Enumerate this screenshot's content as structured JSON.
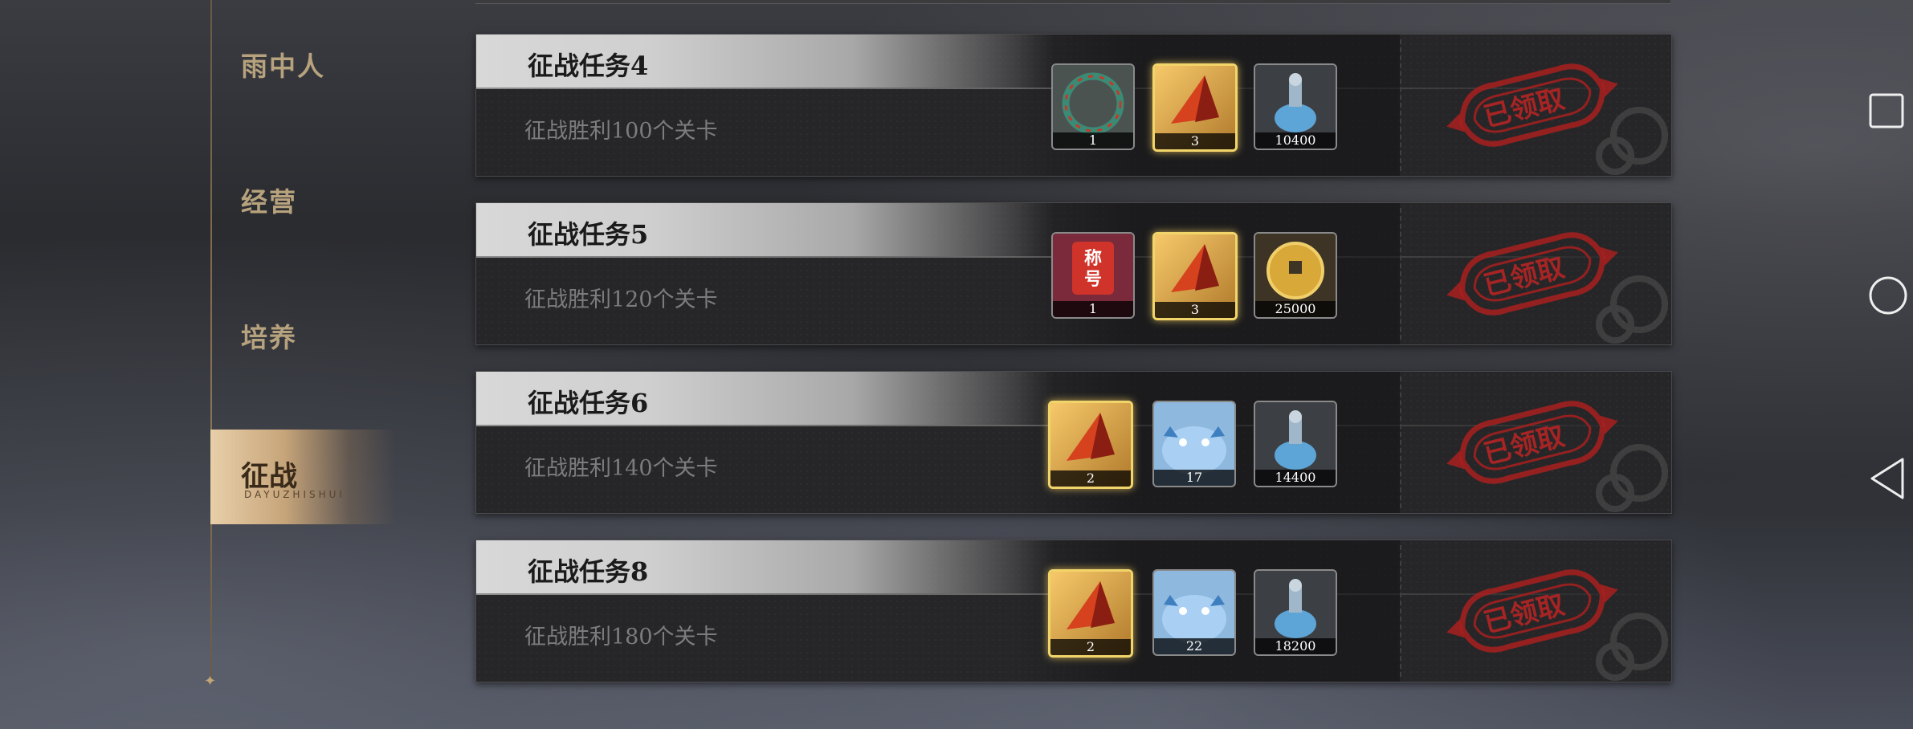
{
  "sidebar": {
    "items": [
      {
        "label": "雨中人"
      },
      {
        "label": "经营"
      },
      {
        "label": "培养"
      }
    ],
    "active": {
      "label": "征战",
      "sub": "DAYUZHISHUI"
    }
  },
  "tasks": [
    {
      "title": "征战任务4",
      "desc": "征战胜利100个关卡",
      "status": "已领取",
      "rewards": [
        {
          "icon": "jade-ring-icon",
          "count": "1"
        },
        {
          "icon": "flame-shard-icon",
          "count": "3"
        },
        {
          "icon": "potion-bottle-icon",
          "count": "10400"
        }
      ]
    },
    {
      "title": "征战任务5",
      "desc": "征战胜利120个关卡",
      "status": "已领取",
      "rewards": [
        {
          "icon": "title-badge-icon",
          "label": "称号",
          "count": "1"
        },
        {
          "icon": "flame-shard-icon",
          "count": "3"
        },
        {
          "icon": "gold-coin-icon",
          "count": "25000"
        }
      ]
    },
    {
      "title": "征战任务6",
      "desc": "征战胜利140个关卡",
      "status": "已领取",
      "rewards": [
        {
          "icon": "flame-shard-icon",
          "count": "2"
        },
        {
          "icon": "blue-creature-icon",
          "count": "17"
        },
        {
          "icon": "potion-bottle-icon",
          "count": "14400"
        }
      ]
    },
    {
      "title": "征战任务8",
      "desc": "征战胜利180个关卡",
      "status": "已领取",
      "rewards": [
        {
          "icon": "flame-shard-icon",
          "count": "2"
        },
        {
          "icon": "blue-creature-icon",
          "count": "22"
        },
        {
          "icon": "potion-bottle-icon",
          "count": "18200"
        }
      ]
    }
  ],
  "colors": {
    "accent_gold": "#f2d56a",
    "stamp_red": "#b52424",
    "sidebar_text": "#b7a27e"
  },
  "nav": {
    "square": "recent-apps-icon",
    "circle": "home-icon",
    "triangle": "back-icon"
  }
}
